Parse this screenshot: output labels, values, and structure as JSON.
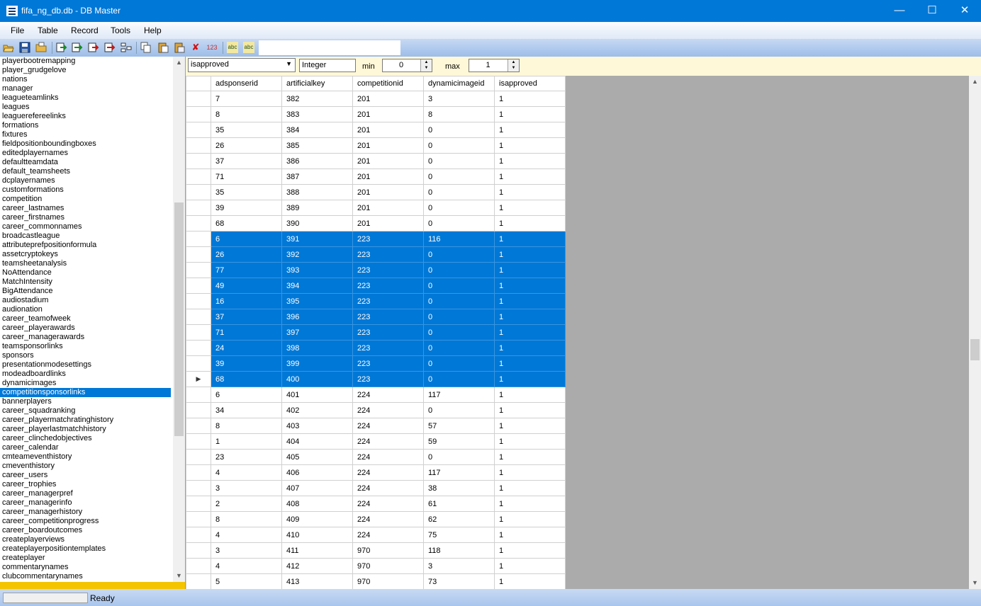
{
  "window": {
    "title": "fifa_ng_db.db - DB Master"
  },
  "menu": [
    "File",
    "Table",
    "Record",
    "Tools",
    "Help"
  ],
  "toolbar": {
    "icons": [
      "open-icon",
      "save-icon",
      "open-folder-icon",
      "import-icon",
      "export-icon",
      "import-red-icon",
      "export-red-icon",
      "tree-icon",
      "copy-icon",
      "paste-icon",
      "paste-special-icon",
      "delete-icon",
      "number-icon",
      "spell-check-icon",
      "spell-check-alt-icon"
    ],
    "delete_glyph": "✘",
    "number_glyph": "123",
    "abc_glyph": "abc"
  },
  "tables": [
    "playerbootremapping",
    "player_grudgelove",
    "nations",
    "manager",
    "leagueteamlinks",
    "leagues",
    "leaguerefereelinks",
    "formations",
    "fixtures",
    "fieldpositionboundingboxes",
    "editedplayernames",
    "defaultteamdata",
    "default_teamsheets",
    "dcplayernames",
    "customformations",
    "competition",
    "career_lastnames",
    "career_firstnames",
    "career_commonnames",
    "broadcastleague",
    "attributeprefpositionformula",
    "assetcryptokeys",
    "teamsheetanalysis",
    "NoAttendance",
    "MatchIntensity",
    "BigAttendance",
    "audiostadium",
    "audionation",
    "career_teamofweek",
    "career_playerawards",
    "career_managerawards",
    "teamsponsorlinks",
    "sponsors",
    "presentationmodesettings",
    "modeadboardlinks",
    "dynamicimages",
    "competitionsponsorlinks",
    "bannerplayers",
    "career_squadranking",
    "career_playermatchratinghistory",
    "career_playerlastmatchhistory",
    "career_clinchedobjectives",
    "career_calendar",
    "cmteameventhistory",
    "cmeventhistory",
    "career_users",
    "career_trophies",
    "career_managerpref",
    "career_managerinfo",
    "career_managerhistory",
    "career_competitionprogress",
    "career_boardoutcomes",
    "createplayerviews",
    "createplayerpositiontemplates",
    "createplayer",
    "commentarynames",
    "clubcommentarynames"
  ],
  "selected_table": "competitionsponsorlinks",
  "filter": {
    "field": "isapproved",
    "type": "Integer",
    "min_label": "min",
    "min_value": "0",
    "max_label": "max",
    "max_value": "1"
  },
  "grid": {
    "columns": [
      "adsponserid",
      "artificialkey",
      "competitionid",
      "dynamicimageid",
      "isapproved"
    ],
    "rows": [
      [
        "7",
        "382",
        "201",
        "3",
        "1"
      ],
      [
        "8",
        "383",
        "201",
        "8",
        "1"
      ],
      [
        "35",
        "384",
        "201",
        "0",
        "1"
      ],
      [
        "26",
        "385",
        "201",
        "0",
        "1"
      ],
      [
        "37",
        "386",
        "201",
        "0",
        "1"
      ],
      [
        "71",
        "387",
        "201",
        "0",
        "1"
      ],
      [
        "35",
        "388",
        "201",
        "0",
        "1"
      ],
      [
        "39",
        "389",
        "201",
        "0",
        "1"
      ],
      [
        "68",
        "390",
        "201",
        "0",
        "1"
      ],
      [
        "6",
        "391",
        "223",
        "116",
        "1"
      ],
      [
        "26",
        "392",
        "223",
        "0",
        "1"
      ],
      [
        "77",
        "393",
        "223",
        "0",
        "1"
      ],
      [
        "49",
        "394",
        "223",
        "0",
        "1"
      ],
      [
        "16",
        "395",
        "223",
        "0",
        "1"
      ],
      [
        "37",
        "396",
        "223",
        "0",
        "1"
      ],
      [
        "71",
        "397",
        "223",
        "0",
        "1"
      ],
      [
        "24",
        "398",
        "223",
        "0",
        "1"
      ],
      [
        "39",
        "399",
        "223",
        "0",
        "1"
      ],
      [
        "68",
        "400",
        "223",
        "0",
        "1"
      ],
      [
        "6",
        "401",
        "224",
        "117",
        "1"
      ],
      [
        "34",
        "402",
        "224",
        "0",
        "1"
      ],
      [
        "8",
        "403",
        "224",
        "57",
        "1"
      ],
      [
        "1",
        "404",
        "224",
        "59",
        "1"
      ],
      [
        "23",
        "405",
        "224",
        "0",
        "1"
      ],
      [
        "4",
        "406",
        "224",
        "117",
        "1"
      ],
      [
        "3",
        "407",
        "224",
        "38",
        "1"
      ],
      [
        "2",
        "408",
        "224",
        "61",
        "1"
      ],
      [
        "8",
        "409",
        "224",
        "62",
        "1"
      ],
      [
        "4",
        "410",
        "224",
        "75",
        "1"
      ],
      [
        "3",
        "411",
        "970",
        "118",
        "1"
      ],
      [
        "4",
        "412",
        "970",
        "3",
        "1"
      ],
      [
        "5",
        "413",
        "970",
        "73",
        "1"
      ]
    ],
    "selected_rows": [
      9,
      10,
      11,
      12,
      13,
      14,
      15,
      16,
      17,
      18
    ],
    "current_row": 18,
    "current_marker": "▶"
  },
  "status": {
    "text": "Ready"
  },
  "colors": {
    "accent": "#0078d7",
    "filter_bg": "#fff8d8",
    "list_footer": "#f5c400"
  }
}
